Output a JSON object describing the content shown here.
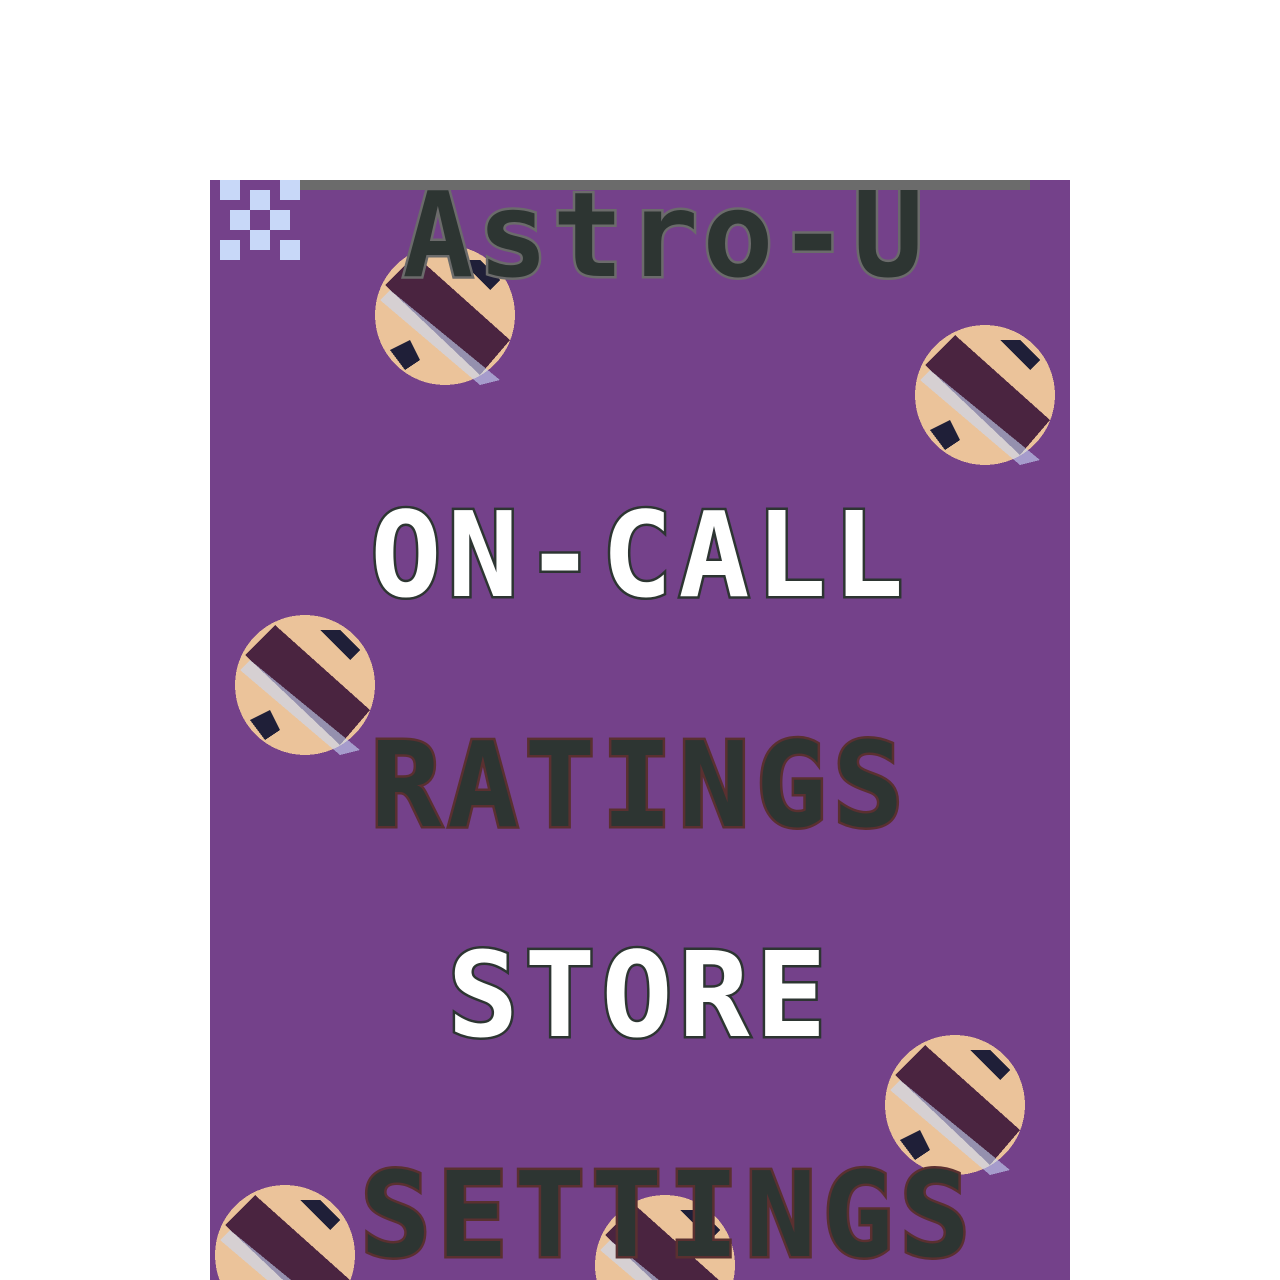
{
  "game": {
    "title": "Astro-U"
  },
  "menu": {
    "items": [
      {
        "label": "ON-CALL",
        "style": "light"
      },
      {
        "label": "RATINGS",
        "style": "dark"
      },
      {
        "label": "STORE",
        "style": "light"
      },
      {
        "label": "SETTINGS",
        "style": "dark"
      }
    ]
  },
  "colors": {
    "background": "#74418a",
    "title_fill": "#2d3532",
    "title_outline": "#6b6b6b",
    "menu_light": "#ffffff",
    "menu_dark": "#2d3532",
    "planet_band": "#4a2440",
    "planet_body": "#ebc39a",
    "planet_highlight": "#c8d8f8",
    "planet_stripe": "#1f1f38"
  },
  "icons": {
    "sparkle": "sparkle-icon",
    "planet": "planet-icon"
  }
}
